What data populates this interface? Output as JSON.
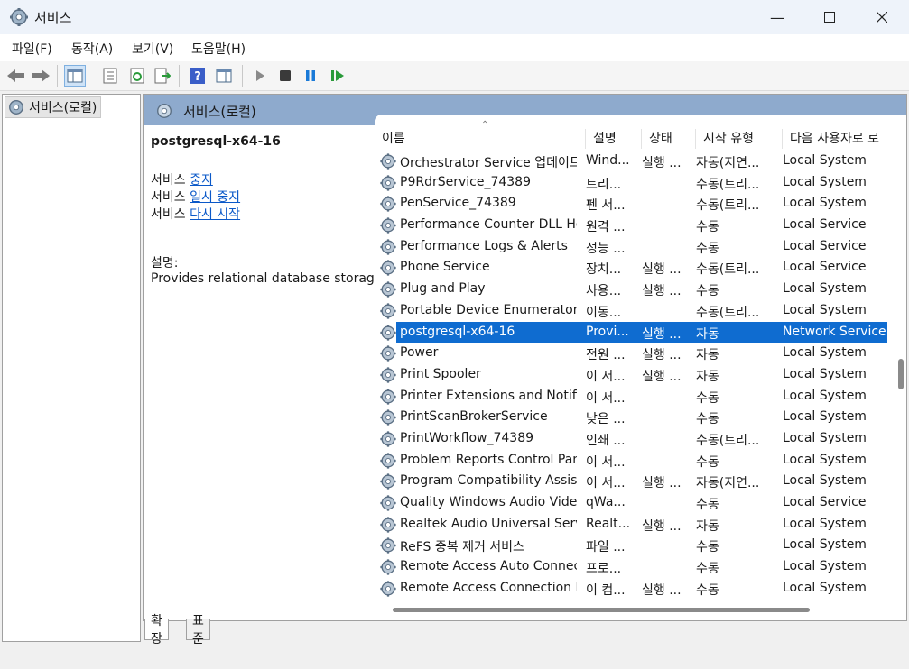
{
  "window": {
    "title": "서비스",
    "minimize_icon": "minimize-icon",
    "maximize_icon": "maximize-icon",
    "close_icon": "close-icon"
  },
  "menu": [
    "파일(F)",
    "동작(A)",
    "보기(V)",
    "도움말(H)"
  ],
  "tree": {
    "root_label": "서비스(로컬)"
  },
  "panel": {
    "header": "서비스(로컬)"
  },
  "detail": {
    "service_name": "postgresql-x64-16",
    "prefix": "서비스",
    "stop": "중지",
    "pause": "일시 중지",
    "restart": "다시 시작",
    "desc_label": "설명:",
    "desc_text": "Provides relational database storage."
  },
  "columns": [
    "이름",
    "설명",
    "상태",
    "시작 유형",
    "다음 사용자로 로"
  ],
  "rows": [
    {
      "name": "Orchestrator Service 업데이트",
      "desc": "Wind...",
      "status": "실행 ...",
      "start": "자동(지연...",
      "logon": "Local System"
    },
    {
      "name": "P9RdrService_74389",
      "desc": "트리...",
      "status": "",
      "start": "수동(트리...",
      "logon": "Local System"
    },
    {
      "name": "PenService_74389",
      "desc": "펜 서...",
      "status": "",
      "start": "수동(트리...",
      "logon": "Local System"
    },
    {
      "name": "Performance Counter DLL Host",
      "desc": "원격 ...",
      "status": "",
      "start": "수동",
      "logon": "Local Service"
    },
    {
      "name": "Performance Logs & Alerts",
      "desc": "성능 ...",
      "status": "",
      "start": "수동",
      "logon": "Local Service"
    },
    {
      "name": "Phone Service",
      "desc": "장치...",
      "status": "실행 ...",
      "start": "수동(트리...",
      "logon": "Local Service"
    },
    {
      "name": "Plug and Play",
      "desc": "사용...",
      "status": "실행 ...",
      "start": "수동",
      "logon": "Local System"
    },
    {
      "name": "Portable Device Enumerator Service",
      "desc": "이동...",
      "status": "",
      "start": "수동(트리...",
      "logon": "Local System"
    },
    {
      "name": "postgresql-x64-16",
      "desc": "Provi...",
      "status": "실행 ...",
      "start": "자동",
      "logon": "Network Service",
      "selected": true
    },
    {
      "name": "Power",
      "desc": "전원 ...",
      "status": "실행 ...",
      "start": "자동",
      "logon": "Local System"
    },
    {
      "name": "Print Spooler",
      "desc": "이 서...",
      "status": "실행 ...",
      "start": "자동",
      "logon": "Local System"
    },
    {
      "name": "Printer Extensions and Notifications",
      "desc": "이 서...",
      "status": "",
      "start": "수동",
      "logon": "Local System"
    },
    {
      "name": "PrintScanBrokerService",
      "desc": "낮은 ...",
      "status": "",
      "start": "수동",
      "logon": "Local System"
    },
    {
      "name": "PrintWorkflow_74389",
      "desc": "인쇄 ...",
      "status": "",
      "start": "수동(트리...",
      "logon": "Local System"
    },
    {
      "name": "Problem Reports Control Panel Support",
      "desc": "이 서...",
      "status": "",
      "start": "수동",
      "logon": "Local System"
    },
    {
      "name": "Program Compatibility Assistant Service",
      "desc": "이 서...",
      "status": "실행 ...",
      "start": "자동(지연...",
      "logon": "Local System"
    },
    {
      "name": "Quality Windows Audio Video Experience",
      "desc": "qWa...",
      "status": "",
      "start": "수동",
      "logon": "Local Service"
    },
    {
      "name": "Realtek Audio Universal Service",
      "desc": "Realt...",
      "status": "실행 ...",
      "start": "자동",
      "logon": "Local System"
    },
    {
      "name": "ReFS 중복 제거 서비스",
      "desc": "파일 ...",
      "status": "",
      "start": "수동",
      "logon": "Local System"
    },
    {
      "name": "Remote Access Auto Connection Manager",
      "desc": "프로...",
      "status": "",
      "start": "수동",
      "logon": "Local System"
    },
    {
      "name": "Remote Access Connection Manager",
      "desc": "이 컴...",
      "status": "실행 ...",
      "start": "수동",
      "logon": "Local System"
    }
  ],
  "tabs": [
    "확장",
    "표준"
  ],
  "colors": {
    "selection": "#0f6cd0",
    "link": "#0a58c8",
    "panel_header": "#8eaacd"
  }
}
